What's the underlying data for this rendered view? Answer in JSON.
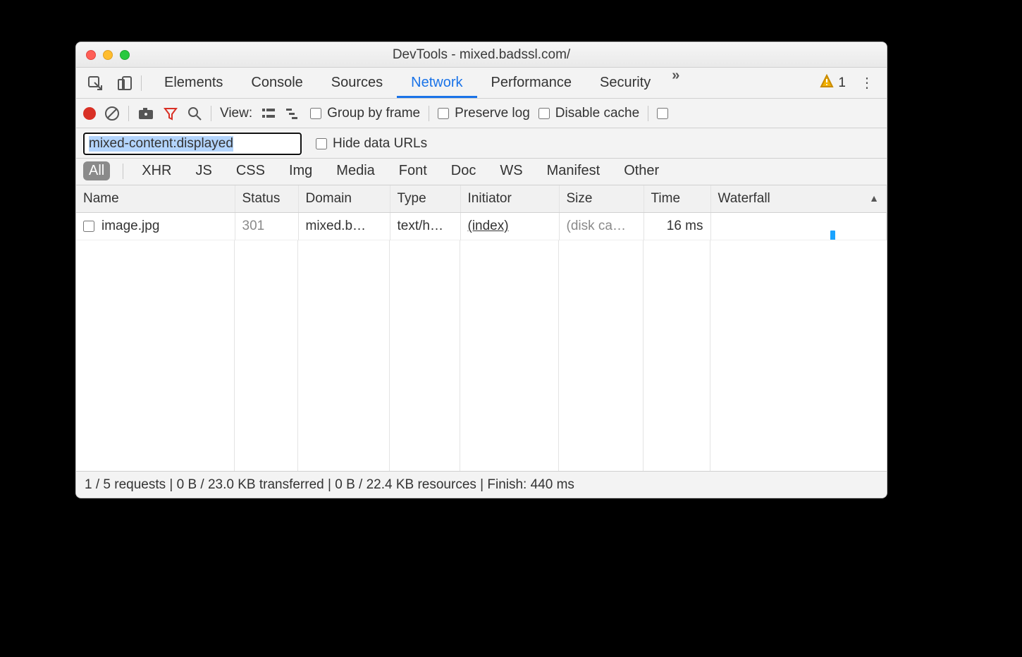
{
  "window": {
    "title": "DevTools - mixed.badssl.com/"
  },
  "tabs": {
    "items": [
      "Elements",
      "Console",
      "Sources",
      "Network",
      "Performance",
      "Security"
    ],
    "active": "Network",
    "warning_count": "1"
  },
  "toolbar": {
    "view_label": "View:",
    "group_by_frame": "Group by frame",
    "preserve_log": "Preserve log",
    "disable_cache": "Disable cache"
  },
  "filter": {
    "value": "mixed-content:displayed",
    "hide_data_urls": "Hide data URLs"
  },
  "types": [
    "All",
    "XHR",
    "JS",
    "CSS",
    "Img",
    "Media",
    "Font",
    "Doc",
    "WS",
    "Manifest",
    "Other"
  ],
  "types_selected": "All",
  "columns": {
    "name": "Name",
    "status": "Status",
    "domain": "Domain",
    "type": "Type",
    "initiator": "Initiator",
    "size": "Size",
    "time": "Time",
    "waterfall": "Waterfall"
  },
  "rows": [
    {
      "name": "image.jpg",
      "status": "301",
      "domain": "mixed.b…",
      "type": "text/h…",
      "initiator": "(index)",
      "size": "(disk ca…",
      "time": "16 ms"
    }
  ],
  "status": "1 / 5 requests | 0 B / 23.0 KB transferred | 0 B / 22.4 KB resources | Finish: 440 ms"
}
